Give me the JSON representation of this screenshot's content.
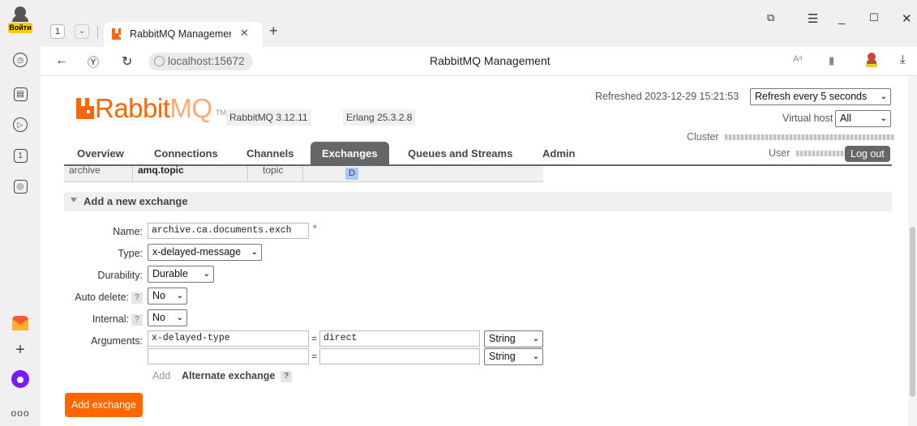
{
  "browser": {
    "login_label": "Войти",
    "tab_count": "1",
    "tab_title": "RabbitMQ Managemen",
    "url": "localhost:15672",
    "page_title": "RabbitMQ Management"
  },
  "header": {
    "logo_rabbit": "Rabbit",
    "logo_mq": "MQ",
    "logo_tm": "TM",
    "version": "RabbitMQ 3.12.11",
    "erlang": "Erlang 25.3.2.8",
    "refreshed": "Refreshed 2023-12-29 15:21:53",
    "refresh_select": "Refresh every 5 seconds",
    "vhost_label": "Virtual host",
    "vhost_select": "All",
    "cluster_label": "Cluster",
    "user_label": "User",
    "logout": "Log out"
  },
  "nav": {
    "tabs": [
      "Overview",
      "Connections",
      "Channels",
      "Exchanges",
      "Queues and Streams",
      "Admin"
    ],
    "active": "Exchanges"
  },
  "table_row": {
    "vhost": "archive",
    "name": "amq.topic",
    "type": "topic",
    "features": "D"
  },
  "form": {
    "section_title": "Add a new exchange",
    "name_label": "Name:",
    "name_value": "archive.ca.documents.exch",
    "required_mark": "*",
    "type_label": "Type:",
    "type_value": "x-delayed-message",
    "durability_label": "Durability:",
    "durability_value": "Durable",
    "auto_delete_label": "Auto delete:",
    "auto_delete_value": "No",
    "internal_label": "Internal:",
    "internal_value": "No",
    "help_mark": "?",
    "arguments_label": "Arguments:",
    "arg1_key": "x-delayed-type",
    "arg1_value": "direct",
    "arg1_type": "String",
    "arg2_key": "",
    "arg2_value": "",
    "arg2_type": "String",
    "eq": "=",
    "add_link": "Add",
    "alternate_exchange": "Alternate exchange",
    "submit": "Add exchange"
  }
}
